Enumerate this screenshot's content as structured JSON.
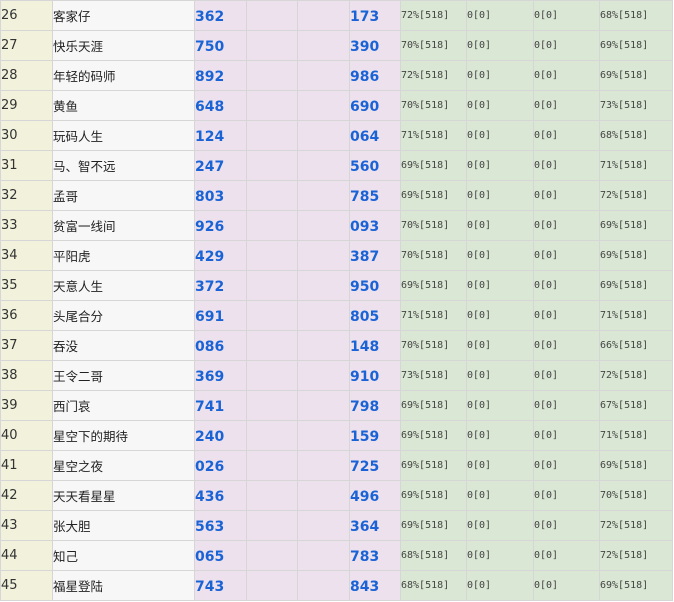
{
  "table": {
    "rows": [
      {
        "rank": "26",
        "name": "客家仔",
        "num1": "362",
        "num2": "173",
        "p1": "72%[518]",
        "p2": "0[0]",
        "p3": "0[0]",
        "p4": "68%[518]"
      },
      {
        "rank": "27",
        "name": "快乐天涯",
        "num1": "750",
        "num2": "390",
        "p1": "70%[518]",
        "p2": "0[0]",
        "p3": "0[0]",
        "p4": "69%[518]"
      },
      {
        "rank": "28",
        "name": "年轻的码师",
        "num1": "892",
        "num2": "986",
        "p1": "72%[518]",
        "p2": "0[0]",
        "p3": "0[0]",
        "p4": "69%[518]"
      },
      {
        "rank": "29",
        "name": "黄鱼",
        "num1": "648",
        "num2": "690",
        "p1": "70%[518]",
        "p2": "0[0]",
        "p3": "0[0]",
        "p4": "73%[518]"
      },
      {
        "rank": "30",
        "name": "玩码人生",
        "num1": "124",
        "num2": "064",
        "p1": "71%[518]",
        "p2": "0[0]",
        "p3": "0[0]",
        "p4": "68%[518]"
      },
      {
        "rank": "31",
        "name": "马、智不远",
        "num1": "247",
        "num2": "560",
        "p1": "69%[518]",
        "p2": "0[0]",
        "p3": "0[0]",
        "p4": "71%[518]"
      },
      {
        "rank": "32",
        "name": "孟哥",
        "num1": "803",
        "num2": "785",
        "p1": "69%[518]",
        "p2": "0[0]",
        "p3": "0[0]",
        "p4": "72%[518]"
      },
      {
        "rank": "33",
        "name": "贫富一线间",
        "num1": "926",
        "num2": "093",
        "p1": "70%[518]",
        "p2": "0[0]",
        "p3": "0[0]",
        "p4": "69%[518]"
      },
      {
        "rank": "34",
        "name": "平阳虎",
        "num1": "429",
        "num2": "387",
        "p1": "70%[518]",
        "p2": "0[0]",
        "p3": "0[0]",
        "p4": "69%[518]"
      },
      {
        "rank": "35",
        "name": "天意人生",
        "num1": "372",
        "num2": "950",
        "p1": "69%[518]",
        "p2": "0[0]",
        "p3": "0[0]",
        "p4": "69%[518]"
      },
      {
        "rank": "36",
        "name": "头尾合分",
        "num1": "691",
        "num2": "805",
        "p1": "71%[518]",
        "p2": "0[0]",
        "p3": "0[0]",
        "p4": "71%[518]"
      },
      {
        "rank": "37",
        "name": "吞没",
        "num1": "086",
        "num2": "148",
        "p1": "70%[518]",
        "p2": "0[0]",
        "p3": "0[0]",
        "p4": "66%[518]"
      },
      {
        "rank": "38",
        "name": "王令二哥",
        "num1": "369",
        "num2": "910",
        "p1": "73%[518]",
        "p2": "0[0]",
        "p3": "0[0]",
        "p4": "72%[518]"
      },
      {
        "rank": "39",
        "name": "西门哀",
        "num1": "741",
        "num2": "798",
        "p1": "69%[518]",
        "p2": "0[0]",
        "p3": "0[0]",
        "p4": "67%[518]"
      },
      {
        "rank": "40",
        "name": "星空下的期待",
        "num1": "240",
        "num2": "159",
        "p1": "69%[518]",
        "p2": "0[0]",
        "p3": "0[0]",
        "p4": "71%[518]"
      },
      {
        "rank": "41",
        "name": "星空之夜",
        "num1": "026",
        "num2": "725",
        "p1": "69%[518]",
        "p2": "0[0]",
        "p3": "0[0]",
        "p4": "69%[518]"
      },
      {
        "rank": "42",
        "name": "天天看星星",
        "num1": "436",
        "num2": "496",
        "p1": "69%[518]",
        "p2": "0[0]",
        "p3": "0[0]",
        "p4": "70%[518]"
      },
      {
        "rank": "43",
        "name": "张大胆",
        "num1": "563",
        "num2": "364",
        "p1": "69%[518]",
        "p2": "0[0]",
        "p3": "0[0]",
        "p4": "72%[518]"
      },
      {
        "rank": "44",
        "name": "知己",
        "num1": "065",
        "num2": "783",
        "p1": "68%[518]",
        "p2": "0[0]",
        "p3": "0[0]",
        "p4": "72%[518]"
      },
      {
        "rank": "45",
        "name": "福星登陆",
        "num1": "743",
        "num2": "843",
        "p1": "68%[518]",
        "p2": "0[0]",
        "p3": "0[0]",
        "p4": "69%[518]"
      }
    ]
  },
  "colors": {
    "rank_bg": "#f1f1dc",
    "name_bg": "#f7f7f7",
    "number_bg": "#ece1ec",
    "number_text": "#1a63d6",
    "stat_bg": "#dae7d4",
    "border": "#d6d6d6"
  }
}
